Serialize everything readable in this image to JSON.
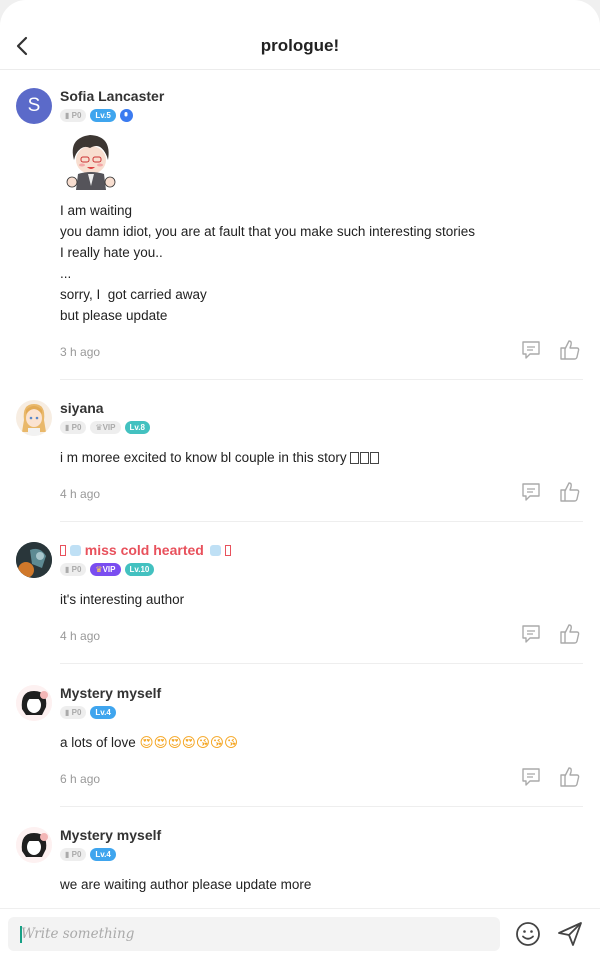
{
  "header": {
    "title": "prologue!"
  },
  "comments": [
    {
      "name": "Sofia Lancaster",
      "avatar_letter": "S",
      "p0": "P0",
      "level": "Lv.5",
      "lines": [
        "I am waiting",
        "you damn idiot, you are at fault that you make such interesting stories",
        "I really hate you..",
        "...",
        "sorry, I  got carried away",
        "but please update"
      ],
      "time": "3 h ago"
    },
    {
      "name": "siyana",
      "p0": "P0",
      "vip": "VIP",
      "level": "Lv.8",
      "lines": [
        "i m moree excited to know bl couple in this story "
      ],
      "time": "4 h ago"
    },
    {
      "name": "miss cold hearted",
      "p0": "P0",
      "vip": "VIP",
      "level": "Lv.10",
      "lines": [
        "it's interesting author"
      ],
      "time": "4 h ago"
    },
    {
      "name": "Mystery myself",
      "p0": "P0",
      "level": "Lv.4",
      "lines": [
        "a lots of love "
      ],
      "emojis": "😍😍😍😍😘😘😘",
      "time": "6 h ago"
    },
    {
      "name": "Mystery myself",
      "p0": "P0",
      "level": "Lv.4",
      "lines": [
        "we are waiting author please update more"
      ]
    }
  ],
  "composer": {
    "placeholder": "Write something"
  },
  "icons": {
    "back": "chevron-left-icon",
    "reply": "comment-icon",
    "like": "thumbs-up-icon",
    "emoji": "smiley-icon",
    "send": "send-icon"
  },
  "colors": {
    "level_badge": "#3fa5ee",
    "vip_name": "#e8515c",
    "avatar_s": "#5b6ac9"
  }
}
